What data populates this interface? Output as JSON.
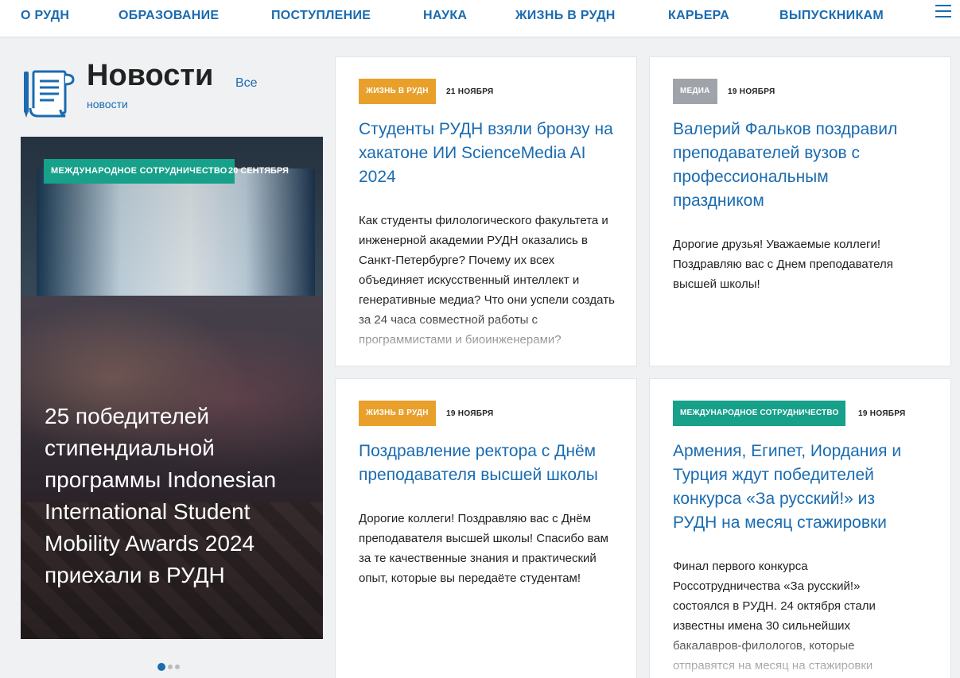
{
  "nav": {
    "items": [
      "О РУДН",
      "ОБРАЗОВАНИЕ",
      "ПОСТУПЛЕНИЕ",
      "НАУКА",
      "ЖИЗНЬ В РУДН",
      "КАРЬЕРА",
      "ВЫПУСКНИКАМ"
    ],
    "menu_icon": "hamburger-menu-icon"
  },
  "section": {
    "title": "Новости",
    "all_link_line1": "Все",
    "all_link_line2": "новости",
    "icon": "newspaper-scroll-icon"
  },
  "featured": {
    "tag": "МЕЖДУНАРОДНОЕ СОТРУДНИЧЕСТВО",
    "tag_color": "#17a08a",
    "date": "20 СЕНТЯБРЯ",
    "headline": "25 победителей стипендиальной программы Indonesian International Student Mobility Awards 2024 приехали в РУДН"
  },
  "carousel": {
    "count": 3,
    "active": 0
  },
  "cards": [
    {
      "tag": "ЖИЗНЬ В РУДН",
      "tag_color": "#e8a02a",
      "date": "21 НОЯБРЯ",
      "title": "Студенты РУДН взяли бронзу на хакатоне ИИ ScienceMedia AI 2024",
      "text": "Как студенты филологического факультета и инженерной академии РУДН оказались в Санкт-Петербурге? Почему их всех объединяет искусственный интеллект и генеративные медиа? Что они успели создать за 24 часа совместной работы с программистами и биоинженерами?"
    },
    {
      "tag": "МЕДИА",
      "tag_color": "#a0a4aa",
      "date": "19 НОЯБРЯ",
      "title": "Валерий Фальков поздравил преподавателей вузов с профессиональным праздником",
      "text": "Дорогие друзья! Уважаемые коллеги! Поздравляю вас с Днем преподавателя высшей школы!"
    },
    {
      "tag": "ЖИЗНЬ В РУДН",
      "tag_color": "#e8a02a",
      "date": "19 НОЯБРЯ",
      "title": "Поздравление ректора с Днём преподавателя высшей школы",
      "text": "Дорогие коллеги! Поздравляю вас с Днём преподавателя высшей школы! Спасибо вам за те качественные знания и практический опыт, которые вы передаёте студентам!"
    },
    {
      "tag": "МЕЖДУНАРОДНОЕ СОТРУДНИЧЕСТВО",
      "tag_color": "#17a08a",
      "date": "19 НОЯБРЯ",
      "title": "Армения, Египет, Иордания и Турция ждут победителей конкурса «За русский!» из РУДН на месяц стажировки",
      "text": "Финал первого конкурса Россотрудничества «За русский!» состоялся в РУДН. 24 октября стали известны имена 30 сильнейших бакалавров-филологов, которые отправятся на месяц на стажировки"
    }
  ]
}
